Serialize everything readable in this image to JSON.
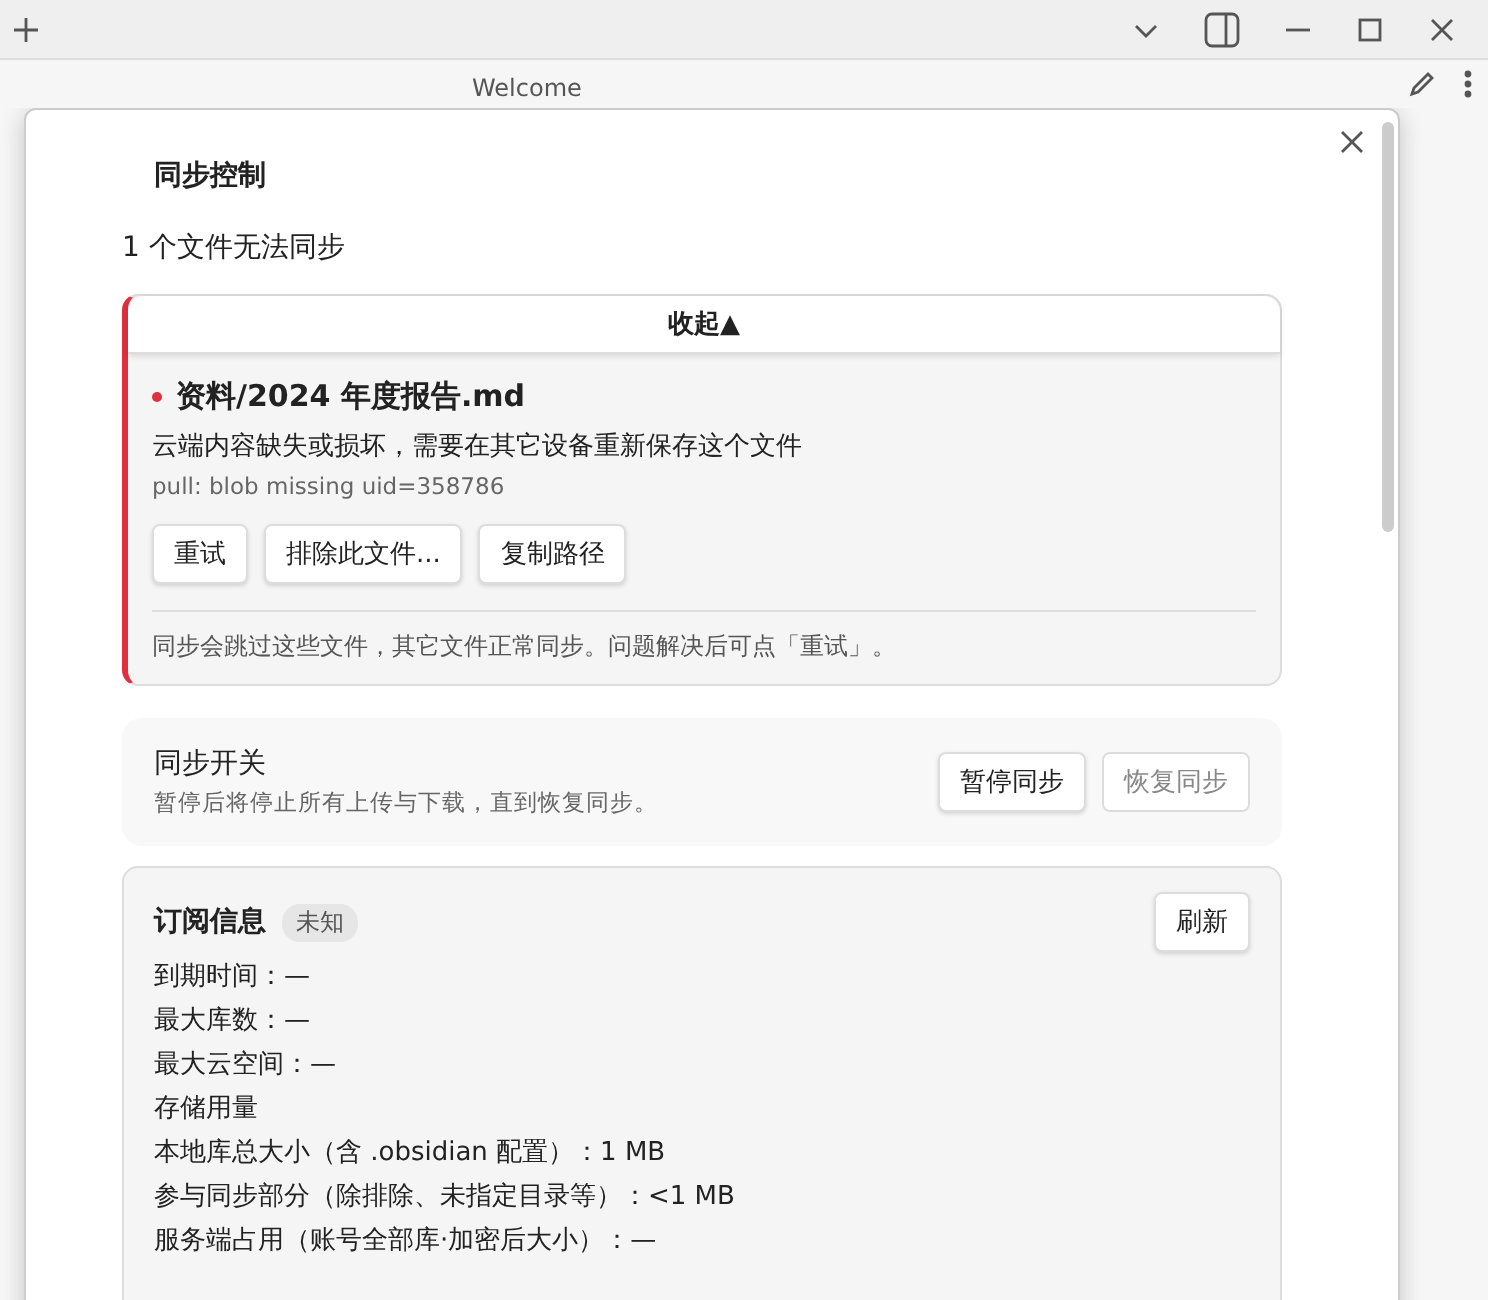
{
  "tab": {
    "title": "Welcome"
  },
  "modal": {
    "title": "同步控制",
    "summary": "1 个文件无法同步",
    "issues_panel": {
      "toggle_label": "收起",
      "toggle_icon": "▲",
      "expanded": true,
      "files": [
        {
          "path": "资料/2024 年度报告.md",
          "color": "#e0303f",
          "message": "云端内容缺失或损坏，需要在其它设备重新保存这个文件",
          "detail": "pull: blob missing uid=358786",
          "actions": [
            "重试",
            "排除此文件...",
            "复制路径"
          ]
        }
      ],
      "note": "同步会跳过这些文件，其它文件正常同步。问题解决后可点「重试」。"
    },
    "sync_switch": {
      "title": "同步开关",
      "description": "暂停后将停止所有上传与下载，直到恢复同步。",
      "buttons": [
        {
          "label": "暂停同步",
          "disabled": false
        },
        {
          "label": "恢复同步",
          "disabled": true
        }
      ]
    },
    "subscription": {
      "title": "订阅信息",
      "badge": "未知",
      "refresh": "刷新",
      "lines": [
        "到期时间：—",
        "最大库数：—",
        "最大云空间：—",
        "存储用量",
        "本地库总大小（含 .obsidian 配置）：1 MB",
        "参与同步部分（除排除、未指定目录等）：<1 MB",
        "服务端占用（账号全部库·加密后大小）：—"
      ]
    }
  }
}
